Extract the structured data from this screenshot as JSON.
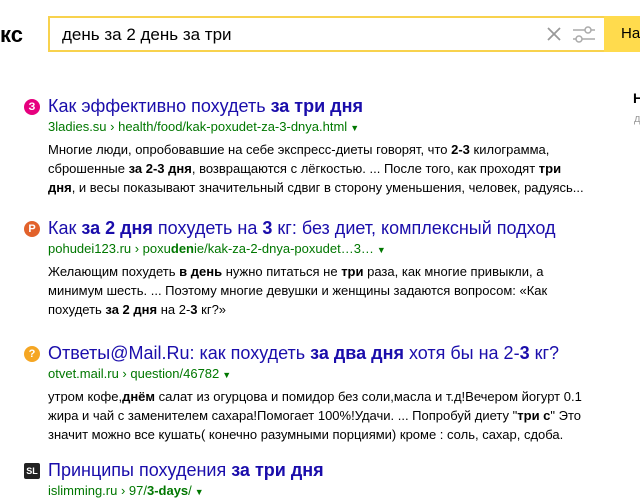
{
  "header": {
    "logo_text": "кс",
    "query": "день за 2 день за три",
    "find_button_label": "На",
    "right_clip_text": "Н",
    "right_clip_sub": "д"
  },
  "colors": {
    "title_link": "#1a0dab",
    "url_green": "#007700",
    "search_border": "#f8d24e",
    "button_yellow": "#ffdb4d"
  },
  "results": [
    {
      "favicon_letter": "З",
      "favicon_color": "#e6007e",
      "title_parts": [
        [
          "Как эффективно похудеть ",
          false
        ],
        [
          "за три дня",
          true
        ]
      ],
      "url_parts": [
        [
          "3ladies.su",
          false
        ],
        [
          " › health/food/kak-poxudet-za-3-dnya.html",
          false
        ]
      ],
      "snippet_lines": [
        [
          [
            "Многие люди, опробовавшие на себе экспресс-диеты говорят, что ",
            false
          ],
          [
            "2-3",
            true
          ],
          [
            " килограмма,",
            false
          ]
        ],
        [
          [
            "сброшенные ",
            false
          ],
          [
            "за 2-3 дня",
            true
          ],
          [
            ", возвращаются с лёгкостью. ... После того, как проходят ",
            false
          ],
          [
            "три",
            true
          ]
        ],
        [
          [
            "дня",
            true
          ],
          [
            ", и весы показывают значительный сдвиг в сторону уменьшения, человек, радуясь...",
            false
          ]
        ]
      ]
    },
    {
      "favicon_letter": "P",
      "favicon_color": "#e2622b",
      "title_parts": [
        [
          "Как ",
          false
        ],
        [
          "за 2 дня",
          true
        ],
        [
          " похудеть на ",
          false
        ],
        [
          "3",
          true
        ],
        [
          " кг: без диет, комплексный подход",
          false
        ]
      ],
      "url_parts": [
        [
          "pohudei123.ru › poxu",
          false
        ],
        [
          "den",
          true
        ],
        [
          "ie/kak-za-2-dnya-poxudet…3…",
          false
        ]
      ],
      "snippet_lines": [
        [
          [
            "Желающим похудеть ",
            false
          ],
          [
            "в день",
            true
          ],
          [
            " нужно питаться не ",
            false
          ],
          [
            "три",
            true
          ],
          [
            " раза, как многие привыкли, а",
            false
          ]
        ],
        [
          [
            "минимум шесть. ... Поэтому многие девушки и женщины задаются вопросом: «Как",
            false
          ]
        ],
        [
          [
            "похудеть ",
            false
          ],
          [
            "за 2 дня",
            true
          ],
          [
            " на 2-",
            false
          ],
          [
            "3",
            true
          ],
          [
            " кг?»",
            false
          ]
        ]
      ]
    },
    {
      "favicon_letter": "?",
      "favicon_color": "#f5a623",
      "title_parts": [
        [
          "Ответы@Mail.Ru: как похудеть ",
          false
        ],
        [
          "за два дня",
          true
        ],
        [
          " хотя бы на 2-",
          false
        ],
        [
          "3",
          true
        ],
        [
          " кг?",
          false
        ]
      ],
      "url_parts": [
        [
          "otvet.mail.ru › question/46782",
          false
        ]
      ],
      "snippet_lines": [
        [
          [
            "утром кофе,",
            false
          ],
          [
            "днём",
            true
          ],
          [
            " салат из огурцова и помидор без соли,масла и т.д!Вечером йогурт 0.1",
            false
          ]
        ],
        [
          [
            "жира и чай с заменителем сахара!Помогает 100%!Удачи. ... Попробуй диету \"",
            false
          ],
          [
            "три с",
            true
          ],
          [
            "\" Это",
            false
          ]
        ],
        [
          [
            "значит можно все кушать( конечно разумными порциями) кроме : соль, сахар, сдоба.",
            false
          ]
        ]
      ]
    },
    {
      "favicon_letter": "SL",
      "favicon_color": "#222222",
      "title_parts": [
        [
          "Принципы похудения ",
          false
        ],
        [
          "за три дня",
          true
        ]
      ],
      "url_parts": [
        [
          "islimming.ru › 97/",
          false
        ],
        [
          "3-days",
          true
        ],
        [
          "/",
          false
        ]
      ],
      "snippet_lines": []
    }
  ]
}
